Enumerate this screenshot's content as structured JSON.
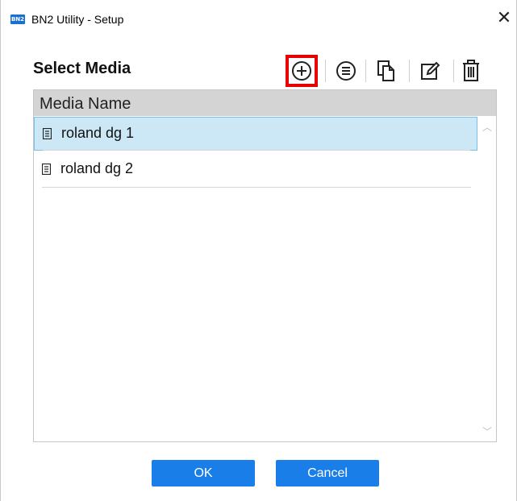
{
  "window": {
    "app_icon_text": "BN2",
    "title": "BN2 Utility - Setup",
    "close_glyph": "✕"
  },
  "heading": "Select Media",
  "toolbar": {
    "icons": [
      "add-icon",
      "list-icon",
      "copy-icon",
      "edit-icon",
      "delete-icon"
    ],
    "highlighted": "add-icon"
  },
  "list": {
    "column_header": "Media Name",
    "items": [
      {
        "label": "roland dg 1",
        "selected": true
      },
      {
        "label": "roland dg 2",
        "selected": false
      }
    ]
  },
  "buttons": {
    "ok": "OK",
    "cancel": "Cancel"
  },
  "colors": {
    "accent": "#1a7ee8",
    "selection_bg": "#cce8f7",
    "highlight_box": "#e60000"
  }
}
